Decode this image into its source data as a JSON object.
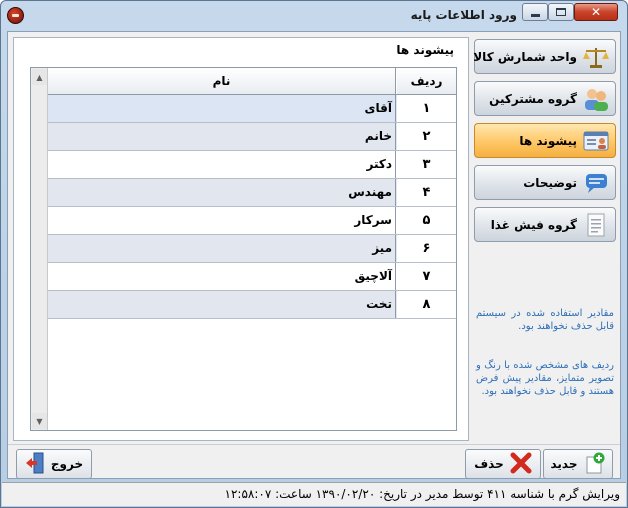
{
  "window": {
    "title": "ورود اطلاعات پایه"
  },
  "left_panel": {
    "caption": "پیشوند ها",
    "columns": {
      "name": "نام",
      "index": "ردیف"
    },
    "rows": [
      {
        "index": "۱",
        "name": "آقای"
      },
      {
        "index": "۲",
        "name": "خانم"
      },
      {
        "index": "۳",
        "name": "دکتر"
      },
      {
        "index": "۴",
        "name": "مهندس"
      },
      {
        "index": "۵",
        "name": "سرکار"
      },
      {
        "index": "۶",
        "name": "میز"
      },
      {
        "index": "۷",
        "name": "آلاچیق"
      },
      {
        "index": "۸",
        "name": "تخت"
      }
    ]
  },
  "nav": [
    {
      "label": "واحد شمارش کالا",
      "icon": "scale-icon"
    },
    {
      "label": "گروه مشترکین",
      "icon": "users-icon"
    },
    {
      "label": "پیشوند ها",
      "icon": "id-card-icon",
      "active": true
    },
    {
      "label": "توضیحات",
      "icon": "comment-icon"
    },
    {
      "label": "گروه فیش غذا",
      "icon": "document-icon"
    }
  ],
  "info": {
    "line1": "مقادیر استفاده شده در سیستم قابل حذف نخواهند بود.",
    "line2": "ردیف های مشخص شده با رنگ و تصویر متمایز، مقادیر پیش فرض هستند و قابل حذف نخواهند بود."
  },
  "buttons": {
    "new": "جدید",
    "delete": "حذف",
    "exit": "خروج"
  },
  "status": {
    "text": "ویرایش گرم با شناسه ۴۱۱ توسط مدیر در تاریخ: ۱۳۹۰/۰۲/۲۰ ساعت: ۱۲:۵۸:۰۷"
  },
  "colors": {
    "active_nav": "#ffc766",
    "info_text": "#2e6fb7",
    "title_bar": "#c6d9ec"
  }
}
